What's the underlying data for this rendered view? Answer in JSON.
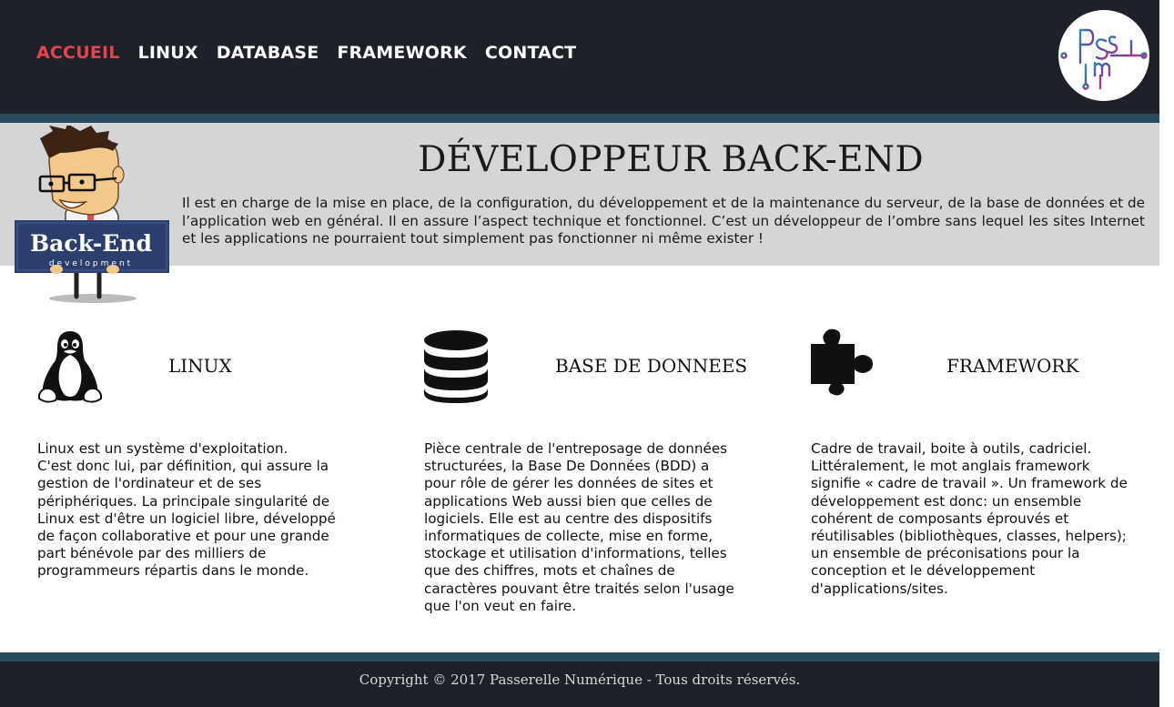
{
  "nav": {
    "items": [
      {
        "label": "ACCUEIL",
        "active": true
      },
      {
        "label": "LINUX",
        "active": false
      },
      {
        "label": "DATABASE",
        "active": false
      },
      {
        "label": "FRAMEWORK",
        "active": false
      },
      {
        "label": "CONTACT",
        "active": false
      }
    ],
    "active_color": "#e5434f"
  },
  "logo": {
    "icon": "passerelle-numerique-logo",
    "text": "PassNum"
  },
  "hero": {
    "title": "DÉVELOPPEUR BACK-END",
    "description": "Il est en charge de la mise en place, de la configuration, du développement et de la maintenance du serveur, de la base de données et de l’application web en général. Il en assure l’aspect technique et fonctionnel. C’est un développeur de l’ombre sans lequel les sites Internet et les applications ne pourraient tout simplement pas fonctionner ni même exister !",
    "mascot_sign": "Back-End",
    "mascot_sign_sub": "development"
  },
  "sections": [
    {
      "icon": "linux-penguin-icon",
      "title": "LINUX",
      "text": "Linux est un système d'exploitation.\nC'est donc lui, par définition, qui assure la gestion de l'ordinateur et de ses périphériques. La principale singularité de Linux est d'être un logiciel libre, développé de façon collaborative et pour une grande part bénévole par des milliers de programmeurs répartis dans le monde."
    },
    {
      "icon": "database-icon",
      "title": "BASE DE DONNEES",
      "text": "Pièce centrale de l'entreposage de données structurées, la Base De Données (BDD) a pour rôle de gérer les données de sites et applications Web aussi bien que celles de logiciels. Elle est au centre des dispositifs informatiques de collecte, mise en forme, stockage et utilisation d'informations, telles que des chiffres, mots et chaînes de caractères pouvant être traités selon l'usage que l'on veut en faire."
    },
    {
      "icon": "puzzle-piece-icon",
      "title": "FRAMEWORK",
      "text": "Cadre de travail, boite à outils, cadriciel.\nLittéralement, le mot anglais framework signifie « cadre de travail ». Un framework de développement est donc: un ensemble cohérent de composants éprouvés et réutilisables (bibliothèques, classes, helpers); un ensemble de préconisations pour la conception et le développement d'applications/sites."
    }
  ],
  "footer": {
    "copyright": "Copyright © 2017 Passerelle Numérique - Tous droits réservés."
  },
  "colors": {
    "header_bg": "#1e2228",
    "stripe": "#2a4b5c",
    "hero_bg": "#d4d5d6"
  }
}
